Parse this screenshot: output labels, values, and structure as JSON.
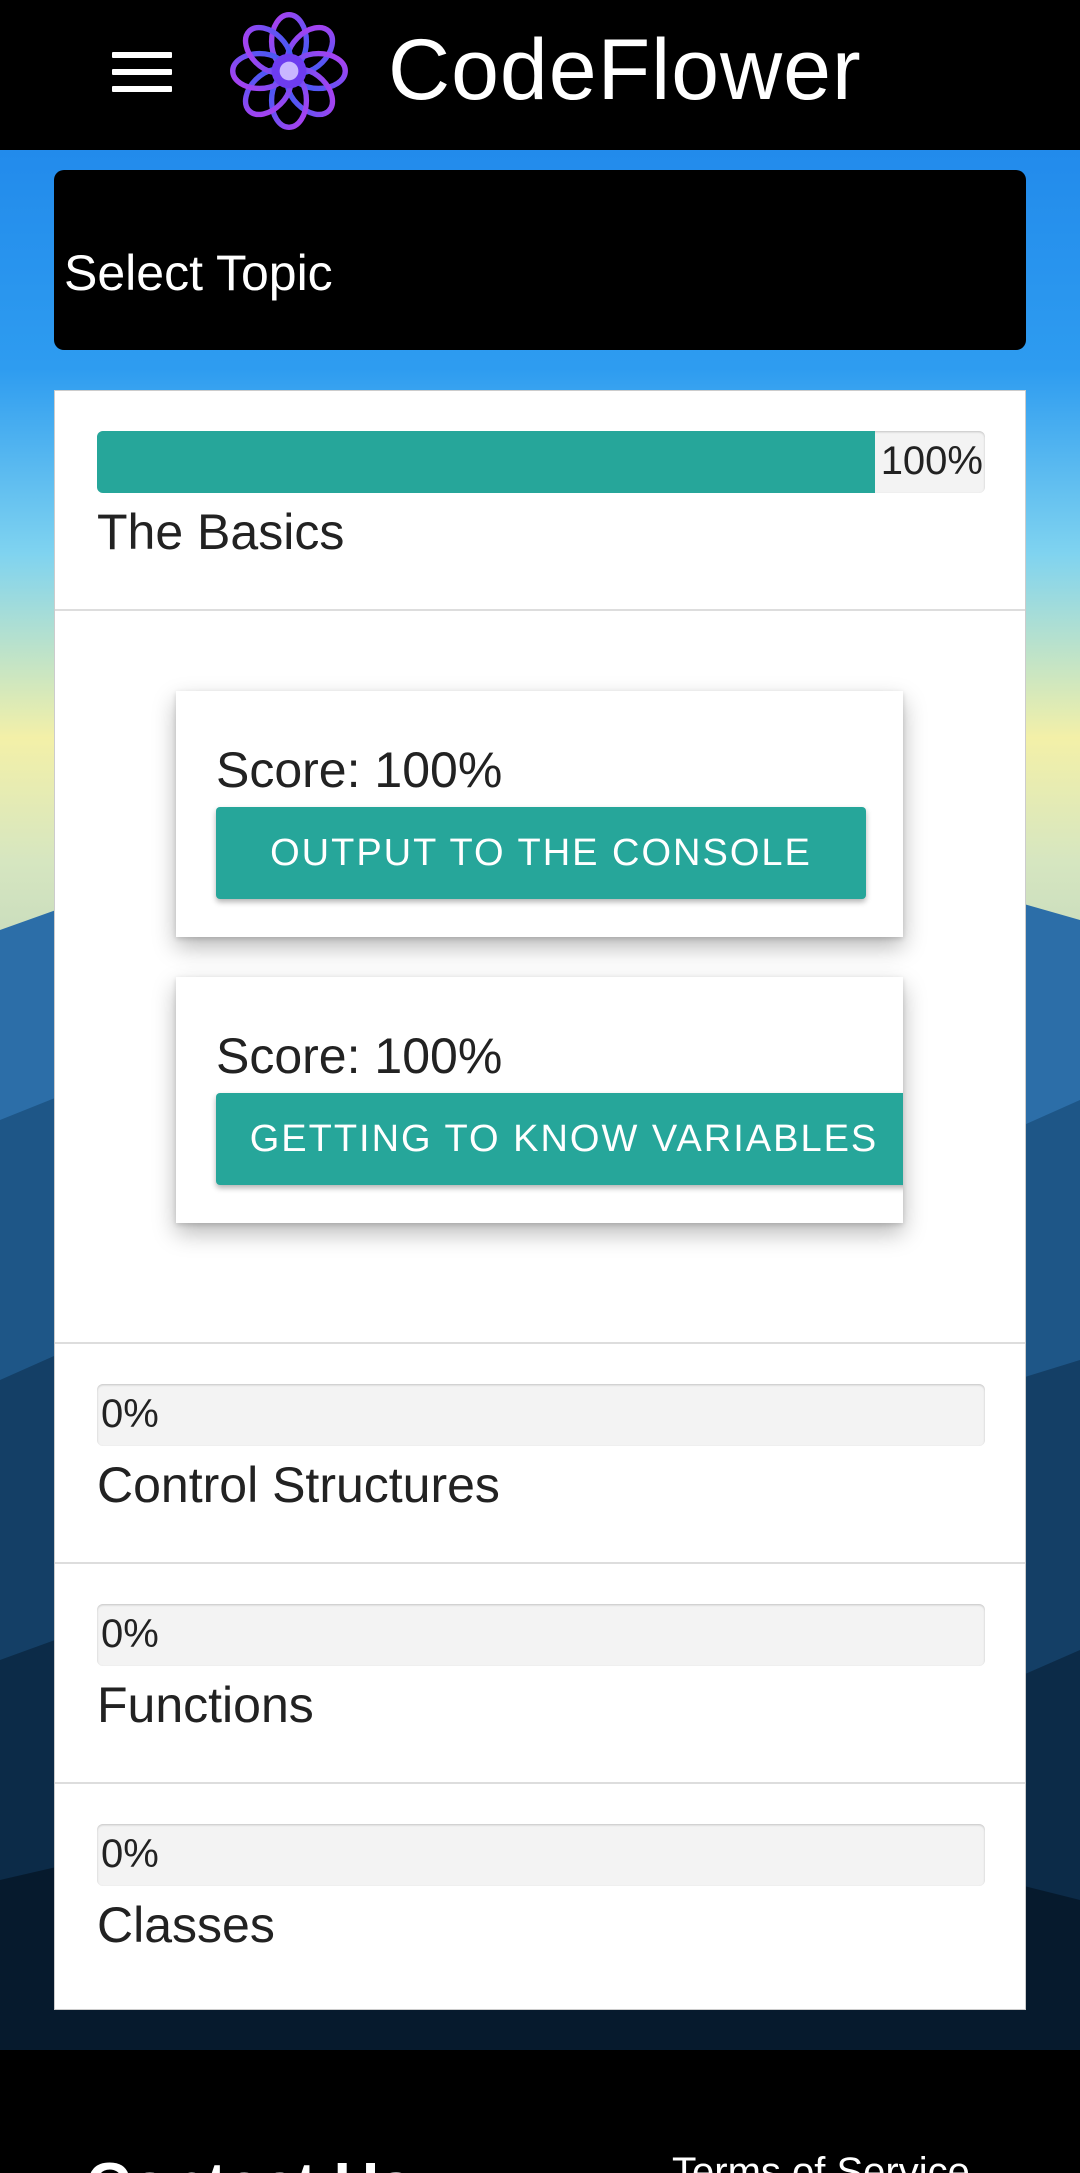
{
  "header": {
    "title": "CodeFlower"
  },
  "select_topic": {
    "label": "Select Topic"
  },
  "topics": [
    {
      "name": "The Basics",
      "progress_label": "100%",
      "progress": 1.0,
      "lessons": [
        {
          "score": "Score: 100%",
          "button": "OUTPUT TO THE CONSOLE"
        },
        {
          "score": "Score: 100%",
          "button": "GETTING TO KNOW VARIABLES"
        }
      ]
    },
    {
      "name": "Control Structures",
      "progress_label": "0%",
      "progress": 0.0
    },
    {
      "name": "Functions",
      "progress_label": "0%",
      "progress": 0.0
    },
    {
      "name": "Classes",
      "progress_label": "0%",
      "progress": 0.0
    }
  ],
  "footer": {
    "contact": "Contact Us",
    "terms": "Terms of Service"
  },
  "colors": {
    "accent": "#26a69a",
    "topbar": "#000000"
  }
}
